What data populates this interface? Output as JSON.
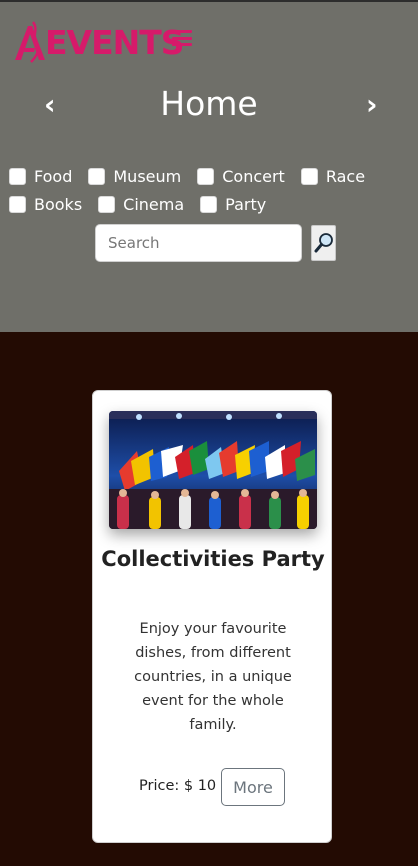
{
  "header": {
    "logo_text": "A EVENTS",
    "logo_suffix": "EVENTS",
    "title": "Home",
    "prev_arrow": "‹",
    "next_arrow": "›",
    "brand_color": "#d61a6a",
    "background": "#6f6f69"
  },
  "filters": {
    "row1": [
      "Food",
      "Museum",
      "Concert",
      "Race"
    ],
    "row2": [
      "Books",
      "Cinema",
      "Party"
    ]
  },
  "search": {
    "placeholder": "Search",
    "value": "",
    "button_icon": "magnifier-icon"
  },
  "event": {
    "title": "Collectivities Party",
    "description": "Enjoy your favourite dishes, from different countries, in a unique event for the whole family.",
    "price_label": "Price: $ 10",
    "more_label": "More",
    "image": "crowd-with-flags-on-stage"
  },
  "colors": {
    "page_background": "#230b03",
    "card_background": "#ffffff"
  }
}
